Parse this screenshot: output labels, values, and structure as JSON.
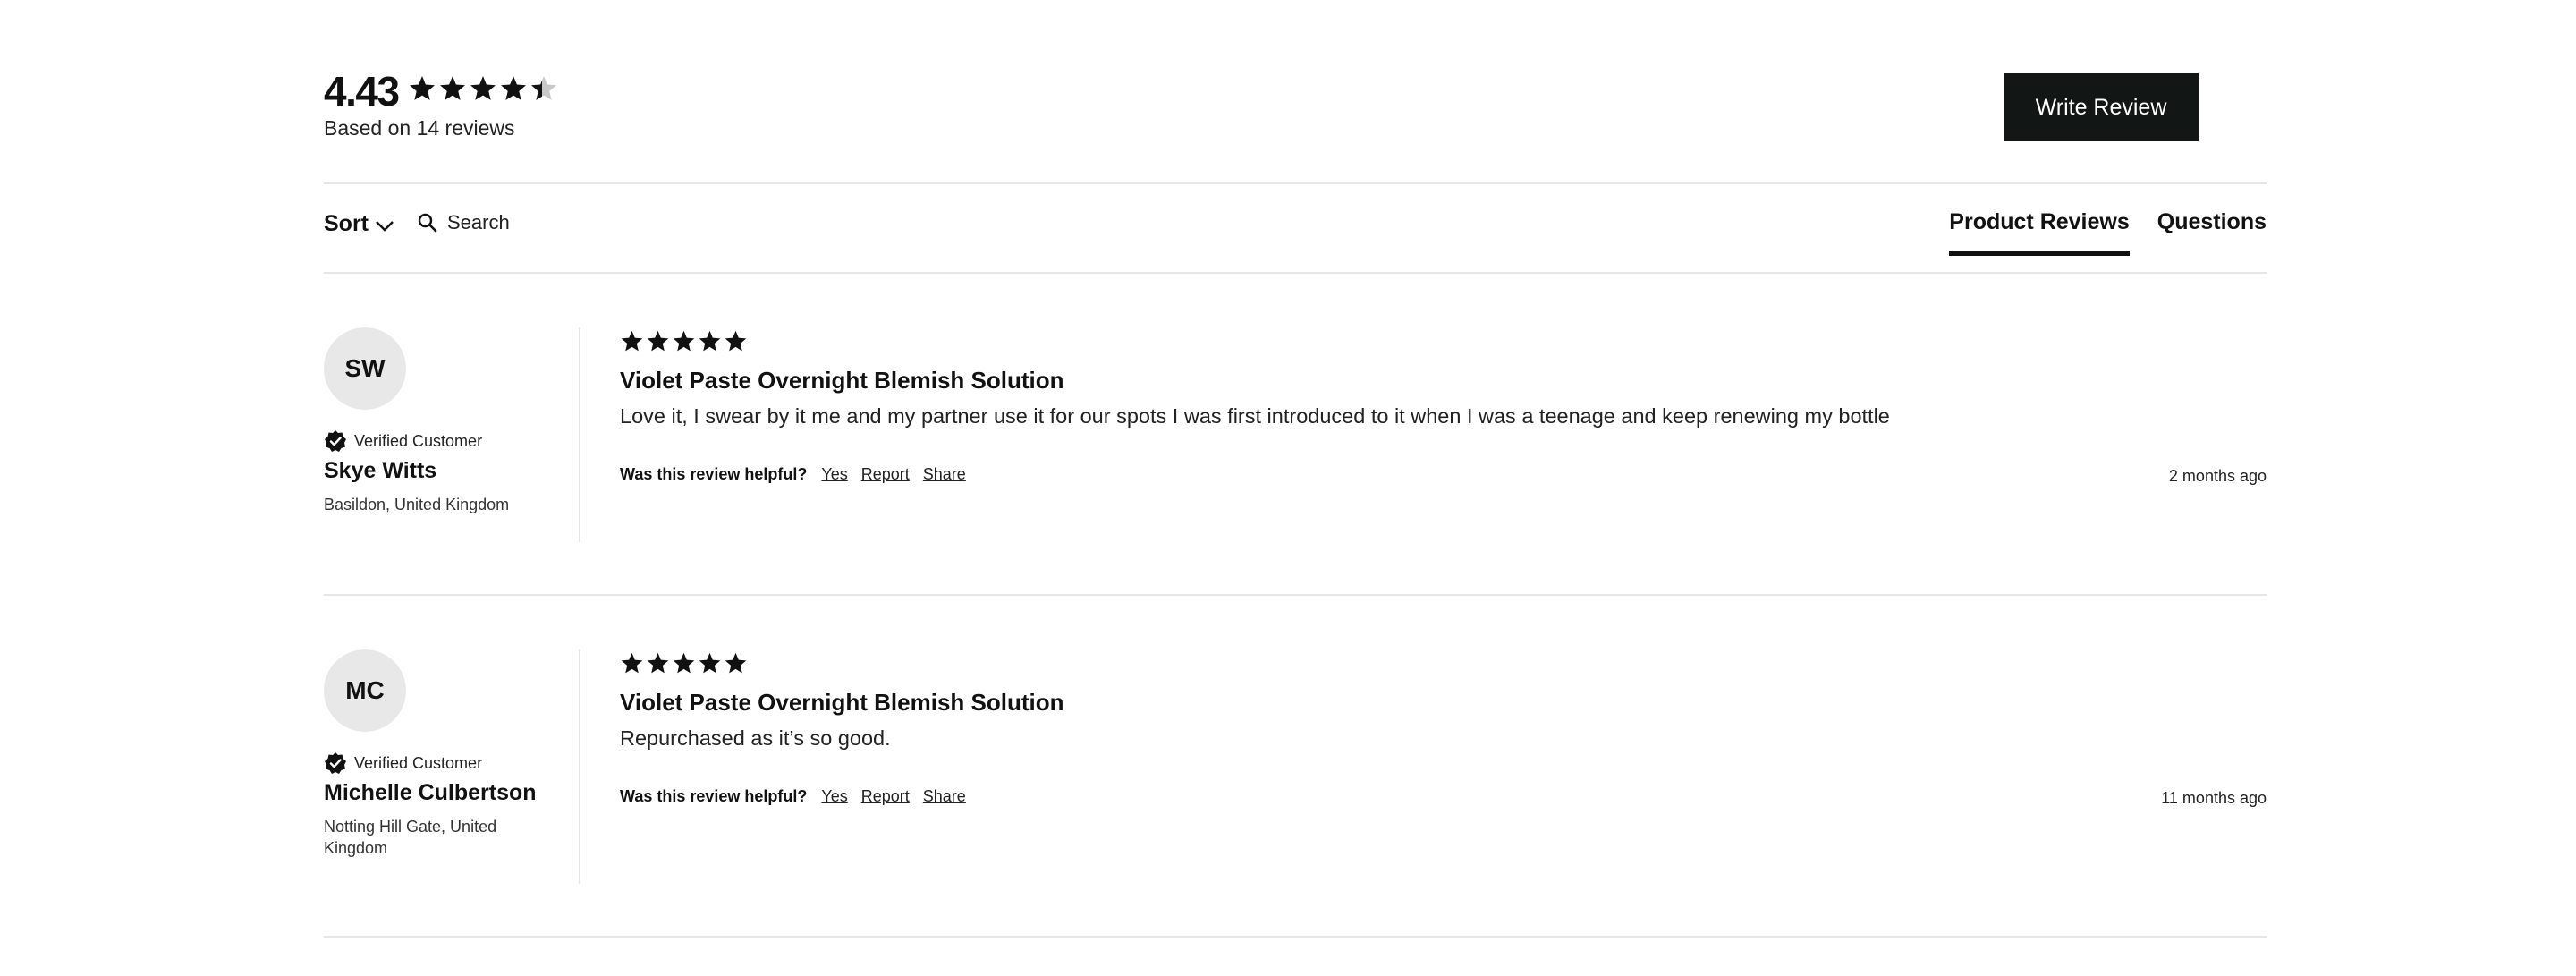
{
  "summary": {
    "rating": "4.43",
    "rating_stars": 4.43,
    "based_on": "Based on 14 reviews",
    "write_review": "Write Review"
  },
  "toolbar": {
    "sort_label": "Sort",
    "search_placeholder": "Search",
    "tabs": [
      {
        "label": "Product Reviews",
        "active": true
      },
      {
        "label": "Questions",
        "active": false
      }
    ]
  },
  "reviews": [
    {
      "initials": "SW",
      "verified_label": "Verified Customer",
      "author": "Skye Witts",
      "location": "Basildon, United Kingdom",
      "stars": 5,
      "title": "Violet Paste Overnight Blemish Solution",
      "body": "Love it, I swear by it me and my partner use it for our spots I was first introduced to it when I was a teenage and keep renewing my bottle",
      "helpful_question": "Was this review helpful?",
      "yes": "Yes",
      "report": "Report",
      "share": "Share",
      "date": "2 months ago"
    },
    {
      "initials": "MC",
      "verified_label": "Verified Customer",
      "author": "Michelle Culbertson",
      "location": "Notting Hill Gate, United Kingdom",
      "stars": 5,
      "title": "Violet Paste Overnight Blemish Solution",
      "body": "Repurchased as it’s so good.",
      "helpful_question": "Was this review helpful?",
      "yes": "Yes",
      "report": "Report",
      "share": "Share",
      "date": "11 months ago"
    }
  ],
  "colors": {
    "button_bg": "#121615",
    "star": "#111111",
    "star_empty": "#c8c8c8",
    "divider": "#e7e7e7",
    "avatar_bg": "#e8e8e8"
  },
  "icons": {
    "chevron": "chevron-down-icon",
    "search": "search-icon",
    "verified": "verified-badge-icon",
    "star": "star-icon"
  }
}
